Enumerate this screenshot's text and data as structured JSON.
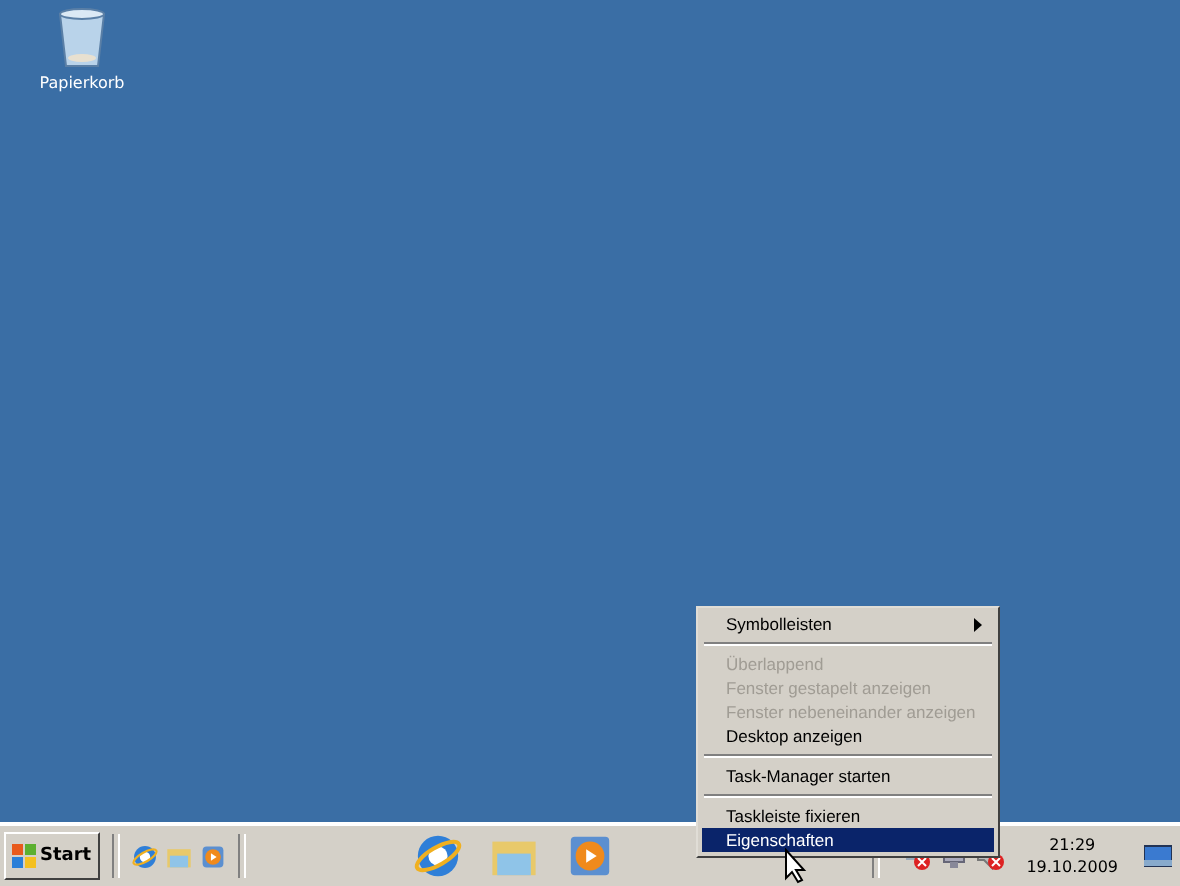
{
  "desktop_icons": [
    {
      "label": "Papierkorb"
    }
  ],
  "context_menu": [
    {
      "kind": "item",
      "label": "Symbolleisten",
      "disabled": false,
      "submenu": true,
      "selected": false
    },
    {
      "kind": "separator"
    },
    {
      "kind": "item",
      "label": "Überlappend",
      "disabled": true,
      "submenu": false,
      "selected": false
    },
    {
      "kind": "item",
      "label": "Fenster gestapelt anzeigen",
      "disabled": true,
      "submenu": false,
      "selected": false
    },
    {
      "kind": "item",
      "label": "Fenster nebeneinander anzeigen",
      "disabled": true,
      "submenu": false,
      "selected": false
    },
    {
      "kind": "item",
      "label": "Desktop anzeigen",
      "disabled": false,
      "submenu": false,
      "selected": false
    },
    {
      "kind": "separator"
    },
    {
      "kind": "item",
      "label": "Task-Manager starten",
      "disabled": false,
      "submenu": false,
      "selected": false
    },
    {
      "kind": "separator"
    },
    {
      "kind": "item",
      "label": "Taskleiste fixieren",
      "disabled": false,
      "submenu": false,
      "selected": false
    },
    {
      "kind": "item",
      "label": "Eigenschaften",
      "disabled": false,
      "submenu": false,
      "selected": true
    }
  ],
  "taskbar": {
    "start_label": "Start",
    "quick_launch": [
      {
        "kind": "browser"
      },
      {
        "kind": "folder"
      },
      {
        "kind": "media"
      }
    ],
    "pinned": [
      {
        "kind": "browser"
      },
      {
        "kind": "folder"
      },
      {
        "kind": "media"
      }
    ],
    "clock": {
      "time": "21:29",
      "date": "19.10.2009"
    }
  }
}
